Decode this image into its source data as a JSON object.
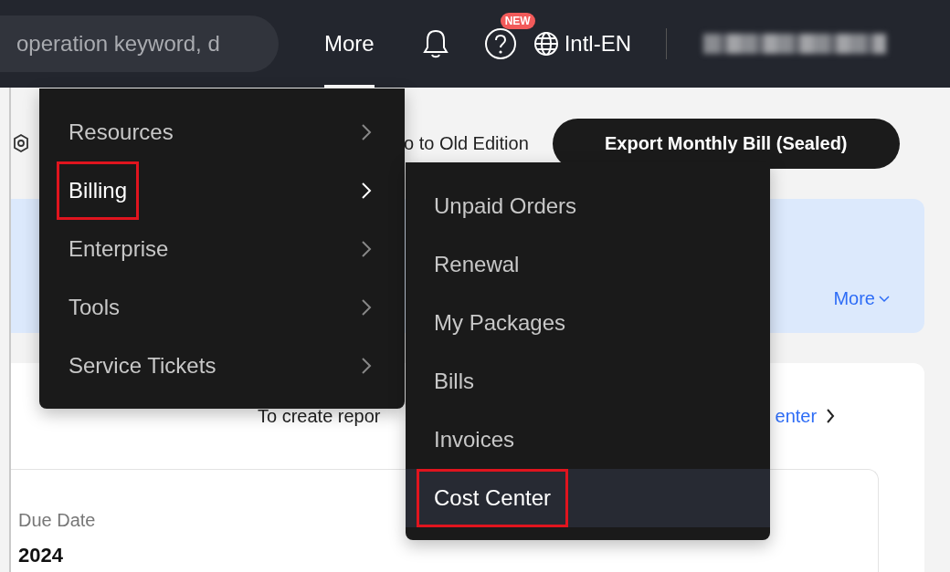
{
  "top_bar": {
    "search": {
      "placeholder": "operation keyword, d"
    },
    "nav": {
      "label": "More",
      "selected": true
    },
    "help_badge": "NEW",
    "language": "Intl-EN"
  },
  "toolbar": {
    "old_edition_link": "o to Old Edition",
    "export_button": "Export Monthly Bill (Sealed)"
  },
  "banner": {
    "more_link": "More"
  },
  "report_card": {
    "hint": "To create repor",
    "link": "enter",
    "due_date_label": "Due Date",
    "due_date_value": "2024"
  },
  "menu": {
    "items": [
      {
        "label": "Resources",
        "selected": false,
        "annotated": false
      },
      {
        "label": "Billing",
        "selected": true,
        "annotated": true
      },
      {
        "label": "Enterprise",
        "selected": false,
        "annotated": false
      },
      {
        "label": "Tools",
        "selected": false,
        "annotated": false
      },
      {
        "label": "Service Tickets",
        "selected": false,
        "annotated": false
      }
    ]
  },
  "submenu": {
    "items": [
      {
        "label": "Unpaid Orders",
        "selected": false,
        "annotated": false
      },
      {
        "label": "Renewal",
        "selected": false,
        "annotated": false
      },
      {
        "label": "My Packages",
        "selected": false,
        "annotated": false
      },
      {
        "label": "Bills",
        "selected": false,
        "annotated": false
      },
      {
        "label": "Invoices",
        "selected": false,
        "annotated": false
      },
      {
        "label": "Cost Center",
        "selected": true,
        "annotated": true
      }
    ]
  }
}
